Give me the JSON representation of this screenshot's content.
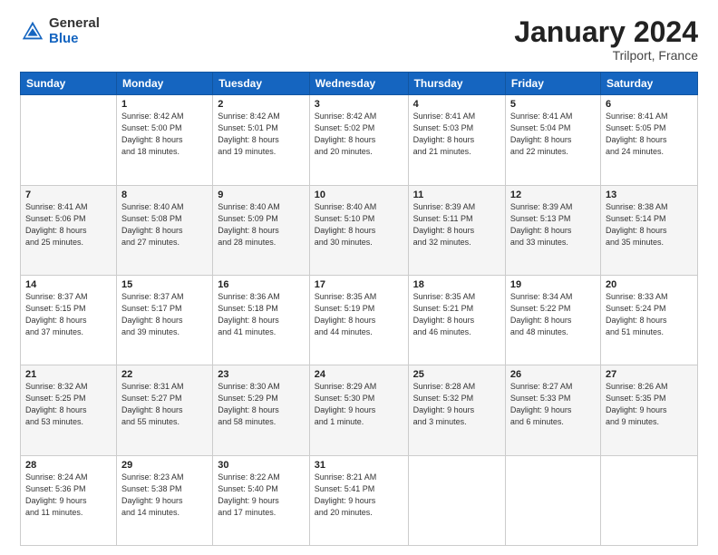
{
  "logo": {
    "general": "General",
    "blue": "Blue"
  },
  "header": {
    "title": "January 2024",
    "subtitle": "Trilport, France"
  },
  "columns": [
    "Sunday",
    "Monday",
    "Tuesday",
    "Wednesday",
    "Thursday",
    "Friday",
    "Saturday"
  ],
  "weeks": [
    [
      {
        "day": "",
        "info": ""
      },
      {
        "day": "1",
        "info": "Sunrise: 8:42 AM\nSunset: 5:00 PM\nDaylight: 8 hours\nand 18 minutes."
      },
      {
        "day": "2",
        "info": "Sunrise: 8:42 AM\nSunset: 5:01 PM\nDaylight: 8 hours\nand 19 minutes."
      },
      {
        "day": "3",
        "info": "Sunrise: 8:42 AM\nSunset: 5:02 PM\nDaylight: 8 hours\nand 20 minutes."
      },
      {
        "day": "4",
        "info": "Sunrise: 8:41 AM\nSunset: 5:03 PM\nDaylight: 8 hours\nand 21 minutes."
      },
      {
        "day": "5",
        "info": "Sunrise: 8:41 AM\nSunset: 5:04 PM\nDaylight: 8 hours\nand 22 minutes."
      },
      {
        "day": "6",
        "info": "Sunrise: 8:41 AM\nSunset: 5:05 PM\nDaylight: 8 hours\nand 24 minutes."
      }
    ],
    [
      {
        "day": "7",
        "info": "Sunrise: 8:41 AM\nSunset: 5:06 PM\nDaylight: 8 hours\nand 25 minutes."
      },
      {
        "day": "8",
        "info": "Sunrise: 8:40 AM\nSunset: 5:08 PM\nDaylight: 8 hours\nand 27 minutes."
      },
      {
        "day": "9",
        "info": "Sunrise: 8:40 AM\nSunset: 5:09 PM\nDaylight: 8 hours\nand 28 minutes."
      },
      {
        "day": "10",
        "info": "Sunrise: 8:40 AM\nSunset: 5:10 PM\nDaylight: 8 hours\nand 30 minutes."
      },
      {
        "day": "11",
        "info": "Sunrise: 8:39 AM\nSunset: 5:11 PM\nDaylight: 8 hours\nand 32 minutes."
      },
      {
        "day": "12",
        "info": "Sunrise: 8:39 AM\nSunset: 5:13 PM\nDaylight: 8 hours\nand 33 minutes."
      },
      {
        "day": "13",
        "info": "Sunrise: 8:38 AM\nSunset: 5:14 PM\nDaylight: 8 hours\nand 35 minutes."
      }
    ],
    [
      {
        "day": "14",
        "info": "Sunrise: 8:37 AM\nSunset: 5:15 PM\nDaylight: 8 hours\nand 37 minutes."
      },
      {
        "day": "15",
        "info": "Sunrise: 8:37 AM\nSunset: 5:17 PM\nDaylight: 8 hours\nand 39 minutes."
      },
      {
        "day": "16",
        "info": "Sunrise: 8:36 AM\nSunset: 5:18 PM\nDaylight: 8 hours\nand 41 minutes."
      },
      {
        "day": "17",
        "info": "Sunrise: 8:35 AM\nSunset: 5:19 PM\nDaylight: 8 hours\nand 44 minutes."
      },
      {
        "day": "18",
        "info": "Sunrise: 8:35 AM\nSunset: 5:21 PM\nDaylight: 8 hours\nand 46 minutes."
      },
      {
        "day": "19",
        "info": "Sunrise: 8:34 AM\nSunset: 5:22 PM\nDaylight: 8 hours\nand 48 minutes."
      },
      {
        "day": "20",
        "info": "Sunrise: 8:33 AM\nSunset: 5:24 PM\nDaylight: 8 hours\nand 51 minutes."
      }
    ],
    [
      {
        "day": "21",
        "info": "Sunrise: 8:32 AM\nSunset: 5:25 PM\nDaylight: 8 hours\nand 53 minutes."
      },
      {
        "day": "22",
        "info": "Sunrise: 8:31 AM\nSunset: 5:27 PM\nDaylight: 8 hours\nand 55 minutes."
      },
      {
        "day": "23",
        "info": "Sunrise: 8:30 AM\nSunset: 5:29 PM\nDaylight: 8 hours\nand 58 minutes."
      },
      {
        "day": "24",
        "info": "Sunrise: 8:29 AM\nSunset: 5:30 PM\nDaylight: 9 hours\nand 1 minute."
      },
      {
        "day": "25",
        "info": "Sunrise: 8:28 AM\nSunset: 5:32 PM\nDaylight: 9 hours\nand 3 minutes."
      },
      {
        "day": "26",
        "info": "Sunrise: 8:27 AM\nSunset: 5:33 PM\nDaylight: 9 hours\nand 6 minutes."
      },
      {
        "day": "27",
        "info": "Sunrise: 8:26 AM\nSunset: 5:35 PM\nDaylight: 9 hours\nand 9 minutes."
      }
    ],
    [
      {
        "day": "28",
        "info": "Sunrise: 8:24 AM\nSunset: 5:36 PM\nDaylight: 9 hours\nand 11 minutes."
      },
      {
        "day": "29",
        "info": "Sunrise: 8:23 AM\nSunset: 5:38 PM\nDaylight: 9 hours\nand 14 minutes."
      },
      {
        "day": "30",
        "info": "Sunrise: 8:22 AM\nSunset: 5:40 PM\nDaylight: 9 hours\nand 17 minutes."
      },
      {
        "day": "31",
        "info": "Sunrise: 8:21 AM\nSunset: 5:41 PM\nDaylight: 9 hours\nand 20 minutes."
      },
      {
        "day": "",
        "info": ""
      },
      {
        "day": "",
        "info": ""
      },
      {
        "day": "",
        "info": ""
      }
    ]
  ]
}
